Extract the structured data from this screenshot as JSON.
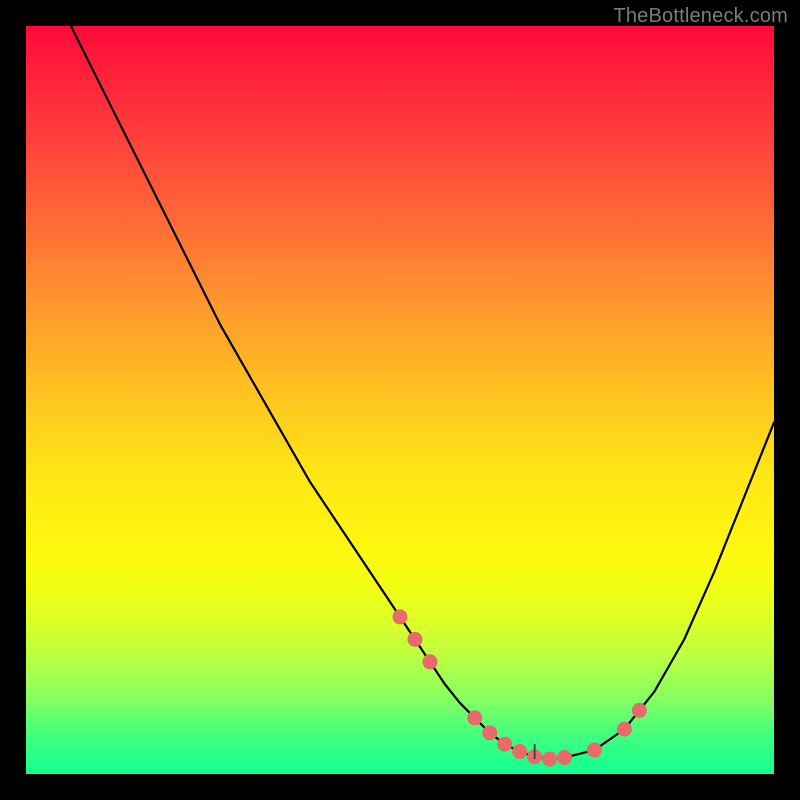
{
  "watermark": {
    "text": "TheBottleneck.com"
  },
  "chart_data": {
    "type": "line",
    "title": "",
    "xlabel": "",
    "ylabel": "",
    "xlim": [
      0,
      100
    ],
    "ylim": [
      0,
      100
    ],
    "curve": {
      "name": "bottleneck-curve",
      "x": [
        6,
        10,
        14,
        18,
        22,
        26,
        30,
        34,
        38,
        42,
        46,
        50,
        52,
        54,
        56,
        58,
        60,
        62,
        64,
        66,
        68,
        70,
        72,
        76,
        80,
        84,
        88,
        92,
        96,
        100
      ],
      "y": [
        100,
        92,
        84,
        76,
        68,
        60,
        53,
        46,
        39,
        33,
        27,
        21,
        18,
        15,
        12,
        9.5,
        7.5,
        5.5,
        4,
        3,
        2.3,
        2,
        2.2,
        3.2,
        6,
        11,
        18,
        27,
        37,
        47
      ]
    },
    "markers": {
      "name": "highlight-points",
      "color": "#e86a6a",
      "x": [
        50,
        52,
        54,
        60,
        62,
        64,
        66,
        68,
        70,
        72,
        76,
        80,
        82
      ],
      "y": [
        21,
        18,
        15,
        7.5,
        5.5,
        4,
        3,
        2.3,
        2,
        2.2,
        3.2,
        6,
        8.5
      ]
    },
    "center_tick": {
      "x": 68,
      "length_pct": 2
    }
  }
}
